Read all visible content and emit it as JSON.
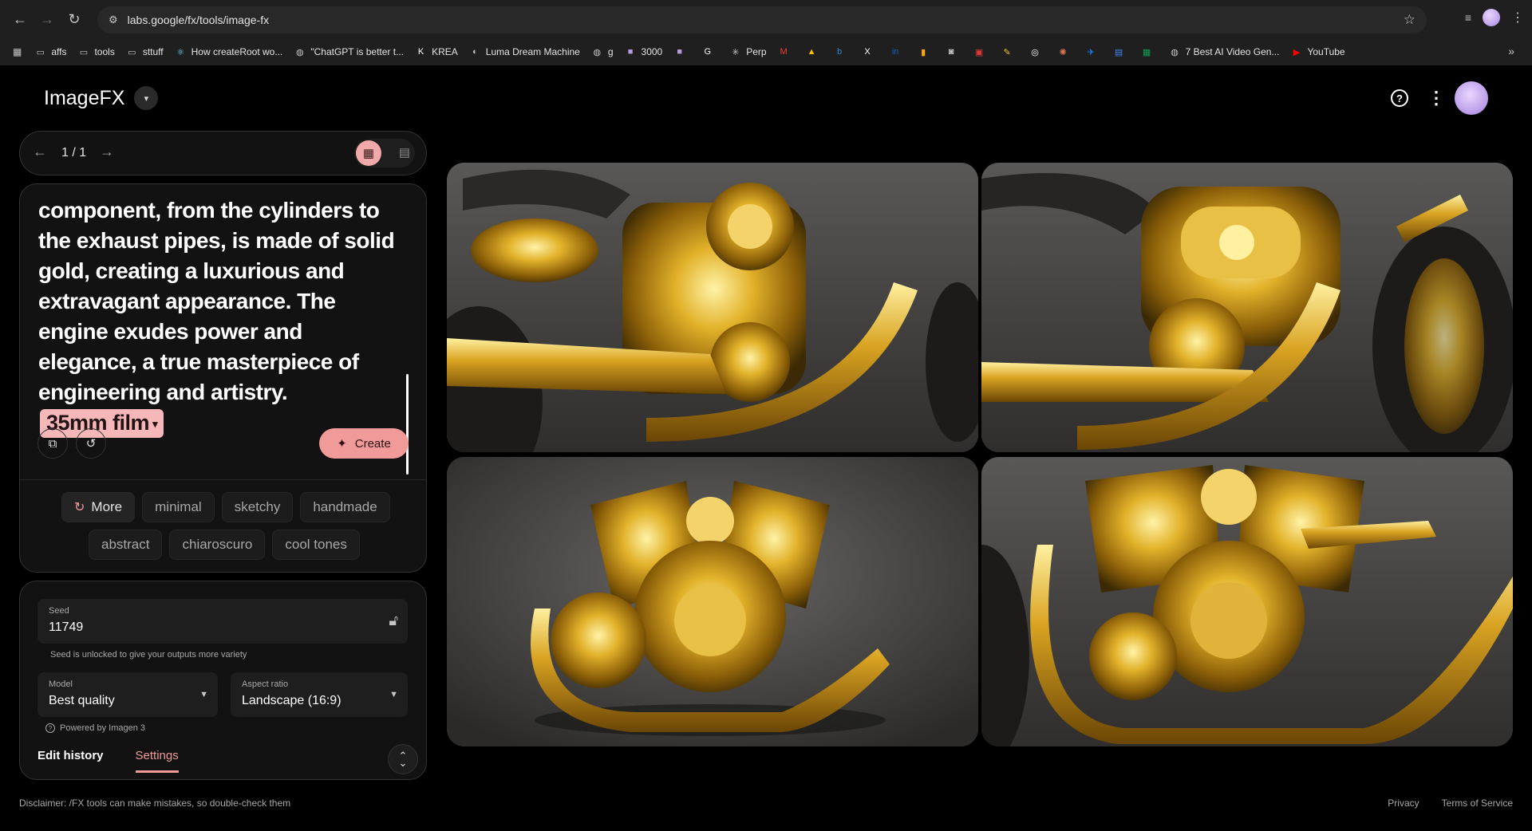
{
  "browser": {
    "url": "labs.google/fx/tools/image-fx",
    "bookmarks": [
      {
        "label": "affs",
        "icon": "folder-icon"
      },
      {
        "label": "tools",
        "icon": "folder-icon"
      },
      {
        "label": "sttuff",
        "icon": "folder-icon"
      },
      {
        "label": "How createRoot wo...",
        "icon": "react-icon"
      },
      {
        "label": "\"ChatGPT is better t...",
        "icon": "globe-icon"
      },
      {
        "label": "KREA",
        "icon": "krea-icon"
      },
      {
        "label": "Luma Dream Machine",
        "icon": "luma-icon"
      },
      {
        "label": "g",
        "icon": "globe-icon"
      },
      {
        "label": "3000",
        "icon": "square-icon"
      },
      {
        "label": "",
        "icon": "square-icon"
      },
      {
        "label": "",
        "icon": "google-icon"
      },
      {
        "label": "Perp",
        "icon": "perplexity-icon"
      },
      {
        "label": "",
        "icon": "gmail-icon"
      },
      {
        "label": "",
        "icon": "drive-icon"
      },
      {
        "label": "",
        "icon": "bing-icon"
      },
      {
        "label": "",
        "icon": "x-icon"
      },
      {
        "label": "",
        "icon": "linkedin-icon"
      },
      {
        "label": "",
        "icon": "analytics-icon"
      },
      {
        "label": "",
        "icon": "game-icon"
      },
      {
        "label": "",
        "icon": "news-icon"
      },
      {
        "label": "",
        "icon": "pencil-icon"
      },
      {
        "label": "",
        "icon": "openai-icon"
      },
      {
        "label": "",
        "icon": "claude-icon"
      },
      {
        "label": "",
        "icon": "bluesky-icon"
      },
      {
        "label": "",
        "icon": "docs-icon"
      },
      {
        "label": "",
        "icon": "sheets-icon"
      },
      {
        "label": "7 Best AI Video Gen...",
        "icon": "globe-icon"
      },
      {
        "label": "YouTube",
        "icon": "youtube-icon"
      }
    ]
  },
  "app": {
    "title": "ImageFX",
    "pager": {
      "count": "1 / 1"
    },
    "prompt": {
      "text": "component, from the cylinders to the exhaust pipes, is made of solid gold, creating a luxurious and extravagant appearance. The engine exudes power and elegance, a true masterpiece of engineering and artistry.",
      "style_chip": "35mm film"
    },
    "create_label": "Create",
    "chips_row1": [
      "minimal",
      "sketchy",
      "handmade"
    ],
    "more_label": "More",
    "chips_row2": [
      "abstract",
      "chiaroscuro",
      "cool tones"
    ],
    "seed": {
      "label": "Seed",
      "value": "11749",
      "help": "Seed is unlocked to give your outputs more variety"
    },
    "model": {
      "label": "Model",
      "value": "Best quality"
    },
    "aspect": {
      "label": "Aspect ratio",
      "value": "Landscape (16:9)"
    },
    "powered_by": "Powered by Imagen 3",
    "tabs": {
      "history": "Edit history",
      "settings": "Settings"
    },
    "disclaimer": "Disclaimer: /FX tools can make mistakes, so double-check them",
    "footer": {
      "privacy": "Privacy",
      "terms": "Terms of Service"
    }
  },
  "colors": {
    "accent": "#f19a9a",
    "chip_bg": "#f6b7b9",
    "gold": "#d4a017",
    "background": "#000000"
  }
}
